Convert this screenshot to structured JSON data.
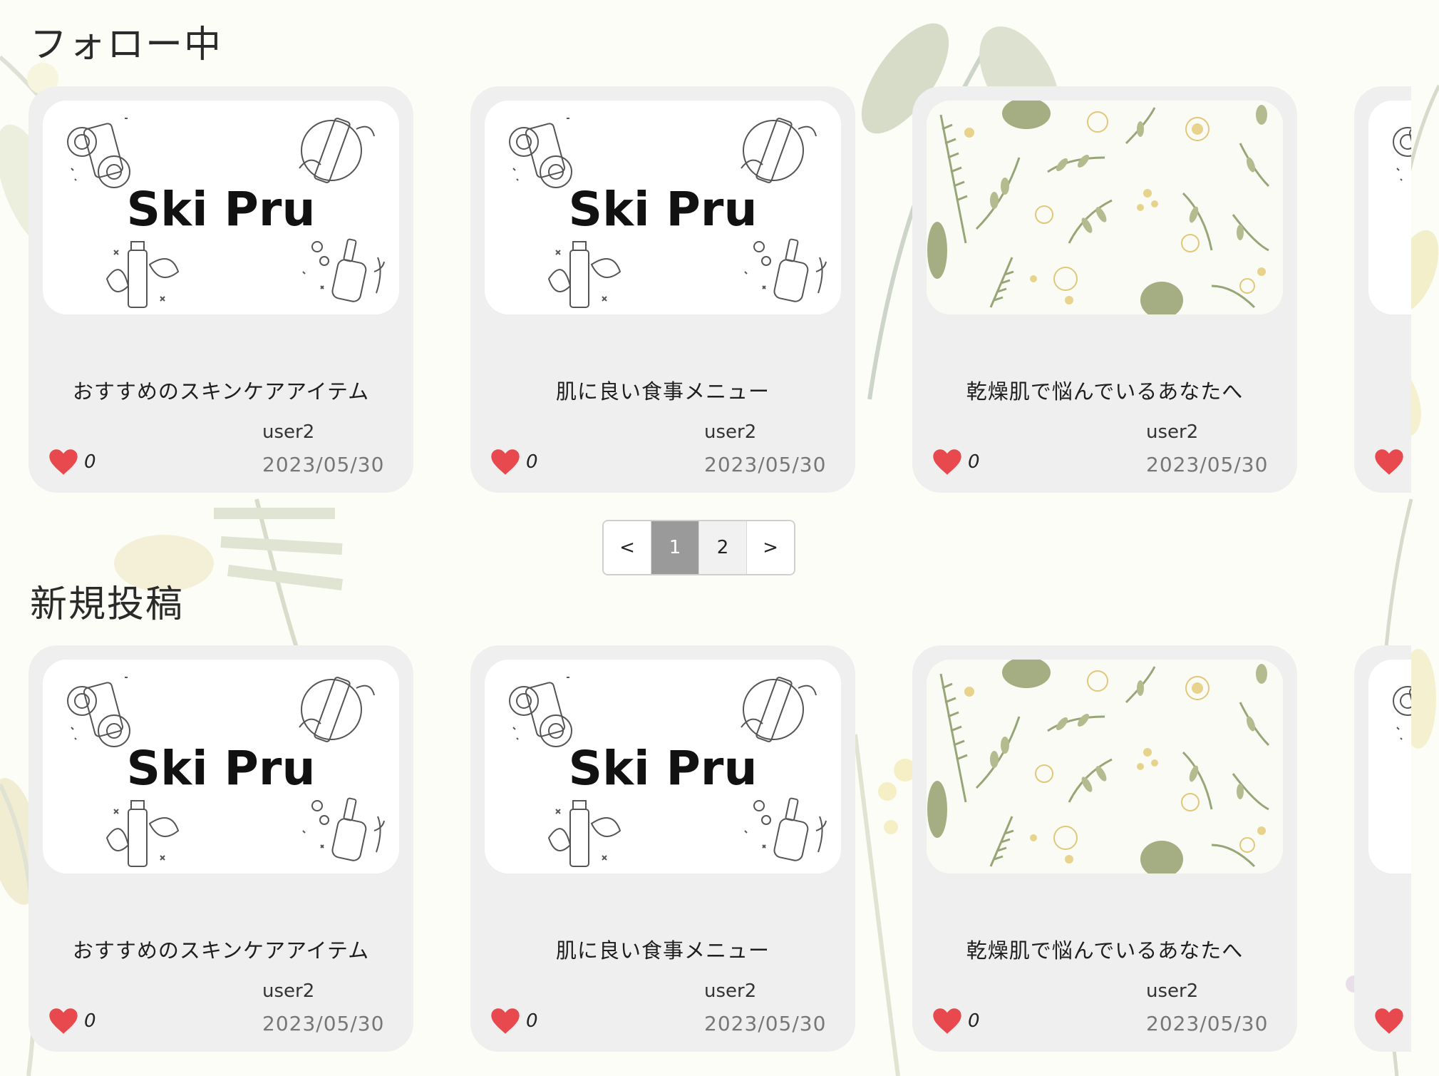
{
  "sections": [
    {
      "title": "フォロー中",
      "cards": [
        {
          "image": "ski-pru-logo",
          "logo_text": "Ski Pru",
          "title": "おすすめのスキンケアアイテム",
          "likes": "0",
          "author": "user2",
          "date": "2023/05/30"
        },
        {
          "image": "ski-pru-logo",
          "logo_text": "Ski Pru",
          "title": "肌に良い食事メニュー",
          "likes": "0",
          "author": "user2",
          "date": "2023/05/30"
        },
        {
          "image": "botanical-pattern",
          "title": "乾燥肌で悩んでいるあなたへ",
          "likes": "0",
          "author": "user2",
          "date": "2023/05/30"
        },
        {
          "image": "ski-pru-logo",
          "partial": true
        }
      ]
    },
    {
      "title": "新規投稿",
      "cards": [
        {
          "image": "ski-pru-logo",
          "logo_text": "Ski Pru",
          "title": "おすすめのスキンケアアイテム",
          "likes": "0",
          "author": "user2",
          "date": "2023/05/30"
        },
        {
          "image": "ski-pru-logo",
          "logo_text": "Ski Pru",
          "title": "肌に良い食事メニュー",
          "likes": "0",
          "author": "user2",
          "date": "2023/05/30"
        },
        {
          "image": "botanical-pattern",
          "title": "乾燥肌で悩んでいるあなたへ",
          "likes": "0",
          "author": "user2",
          "date": "2023/05/30"
        },
        {
          "image": "ski-pru-logo",
          "partial": true
        }
      ]
    }
  ],
  "pagination": {
    "prev": "<",
    "pages": [
      "1",
      "2"
    ],
    "current": "1",
    "next": ">"
  },
  "colors": {
    "heart": "#e8494f",
    "card_bg": "#efefef",
    "active_page": "#9a9a9a",
    "leaf_green": "#9aa878",
    "leaf_yellow": "#e8d58a"
  },
  "icons": {
    "like": "heart-icon"
  }
}
